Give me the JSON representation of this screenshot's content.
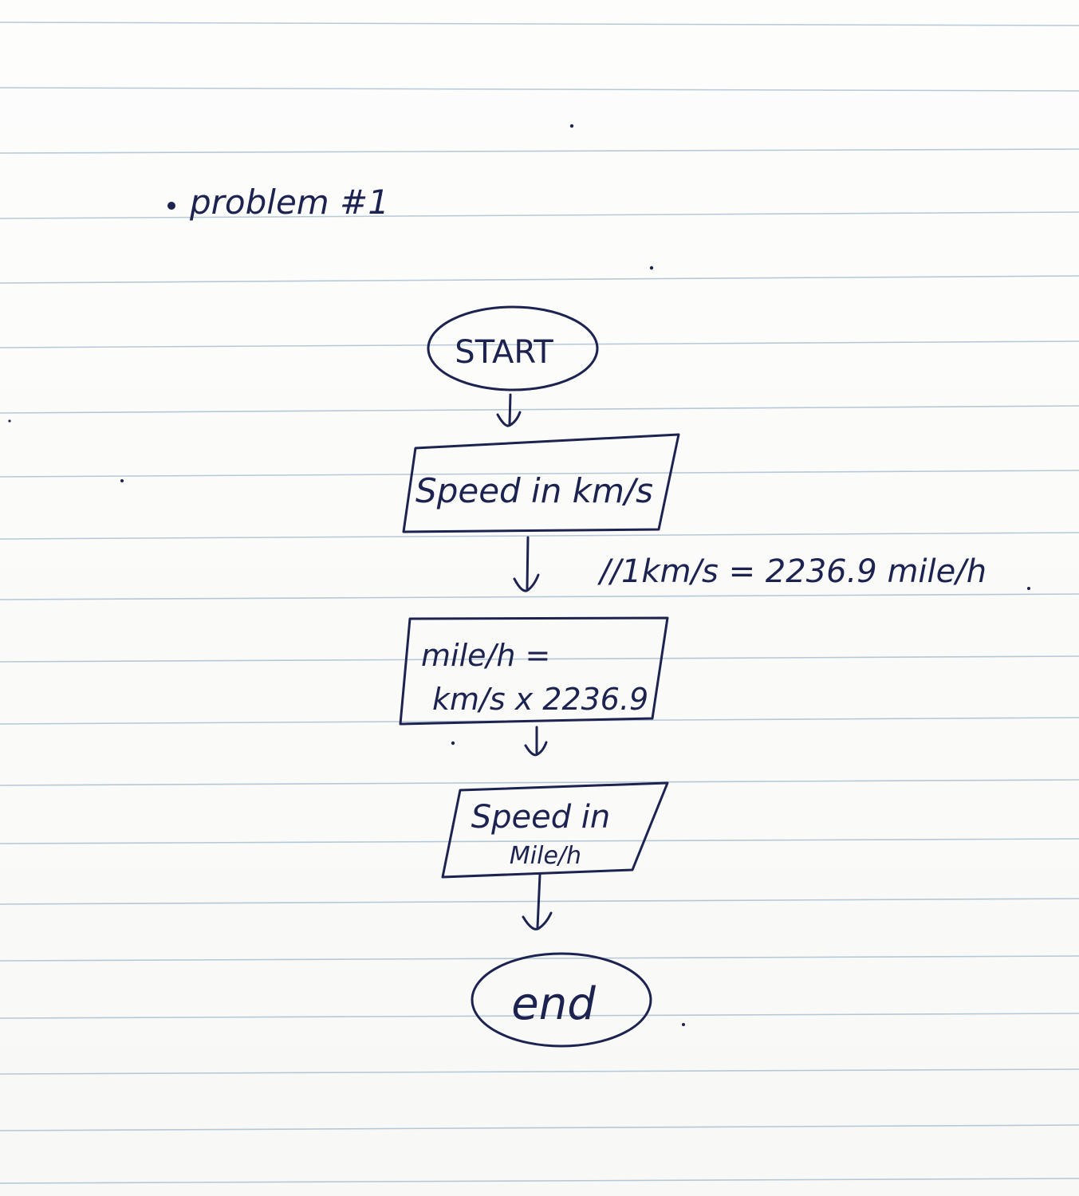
{
  "heading": "problem #1",
  "nodes": [
    {
      "id": "start",
      "shape": "terminator",
      "lines": [
        "START"
      ]
    },
    {
      "id": "input",
      "shape": "input-output",
      "lines": [
        "Speed in km/s"
      ]
    },
    {
      "id": "process",
      "shape": "process",
      "lines": [
        "mile/h =",
        "km/s x 2236.9"
      ]
    },
    {
      "id": "output",
      "shape": "input-output",
      "lines": [
        "Speed in",
        "Mile/h"
      ]
    },
    {
      "id": "end",
      "shape": "terminator",
      "lines": [
        "end"
      ]
    }
  ],
  "annotation": "//1km/s = 2236.9 mile/h",
  "colors": {
    "ink": "#1d2350",
    "paper": "#fbfbfa",
    "rule": "#9fb8cc"
  }
}
